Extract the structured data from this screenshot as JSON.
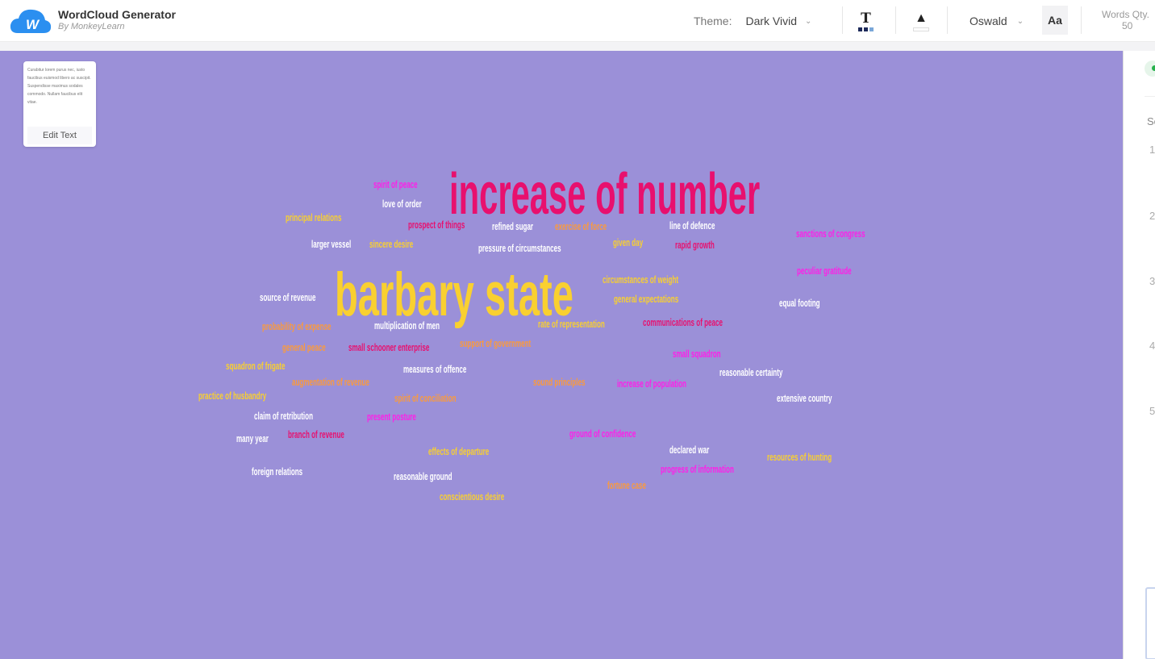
{
  "header": {
    "title": "WordCloud Generator",
    "subtitle": "By MonkeyLearn",
    "theme_label": "Theme:",
    "theme_value": "Dark Vivid",
    "font_value": "Oswald",
    "font_case_label": "Aa",
    "words_qty_label": "Words Qty.",
    "words_qty_value": "50"
  },
  "colors": {
    "canvas_bg": "#9b90d8",
    "pink": "#e8106e",
    "magenta": "#ff1ee8",
    "yellow": "#f9d030",
    "orange": "#fb9a3c",
    "white": "#ffffff"
  },
  "text_card": {
    "preview": "Curabitur lorem purus nec, iusto faucibus euismod libero ac suscipit. Suspendisse maximus sodales commodo. Nullam faucibus elit vitae.",
    "edit_label": "Edit Text"
  },
  "right_panel": {
    "heading": "Se",
    "numbers": [
      "1",
      "2",
      "3",
      "4",
      "5"
    ]
  },
  "words": [
    {
      "text": "increase of number",
      "color": "#e8106e"
    },
    {
      "text": "barbary state",
      "color": "#f9d030"
    },
    {
      "text": "spirit of peace",
      "color": "#ff1ee8"
    },
    {
      "text": "love of order",
      "color": "#ffffff"
    },
    {
      "text": "principal relations",
      "color": "#f9d030"
    },
    {
      "text": "prospect of things",
      "color": "#e8106e"
    },
    {
      "text": "refined sugar",
      "color": "#ffffff"
    },
    {
      "text": "exercise of force",
      "color": "#fb9a3c"
    },
    {
      "text": "line of defence",
      "color": "#ffffff"
    },
    {
      "text": "sanctions of congress",
      "color": "#ff1ee8"
    },
    {
      "text": "larger vessel",
      "color": "#ffffff"
    },
    {
      "text": "sincere desire",
      "color": "#f9d030"
    },
    {
      "text": "pressure of circumstances",
      "color": "#ffffff"
    },
    {
      "text": "given day",
      "color": "#f9d030"
    },
    {
      "text": "rapid growth",
      "color": "#e8106e"
    },
    {
      "text": "peculiar gratitude",
      "color": "#ff1ee8"
    },
    {
      "text": "circumstances of weight",
      "color": "#f9d030"
    },
    {
      "text": "source of revenue",
      "color": "#ffffff"
    },
    {
      "text": "general expectations",
      "color": "#f9d030"
    },
    {
      "text": "equal footing",
      "color": "#ffffff"
    },
    {
      "text": "probability of expense",
      "color": "#fb9a3c"
    },
    {
      "text": "multiplication of men",
      "color": "#ffffff"
    },
    {
      "text": "rate of representation",
      "color": "#f9d030"
    },
    {
      "text": "communications of peace",
      "color": "#e8106e"
    },
    {
      "text": "general peace",
      "color": "#fb9a3c"
    },
    {
      "text": "small schooner enterprise",
      "color": "#e8106e"
    },
    {
      "text": "support of government",
      "color": "#fb9a3c"
    },
    {
      "text": "small squadron",
      "color": "#ff1ee8"
    },
    {
      "text": "squadron of frigate",
      "color": "#f9d030"
    },
    {
      "text": "measures of offence",
      "color": "#ffffff"
    },
    {
      "text": "reasonable certainty",
      "color": "#ffffff"
    },
    {
      "text": "augmentation of revenue",
      "color": "#fb9a3c"
    },
    {
      "text": "sound principles",
      "color": "#fb9a3c"
    },
    {
      "text": "increase of population",
      "color": "#ff1ee8"
    },
    {
      "text": "practice of husbandry",
      "color": "#f9d030"
    },
    {
      "text": "spirit of conciliation",
      "color": "#fb9a3c"
    },
    {
      "text": "extensive country",
      "color": "#ffffff"
    },
    {
      "text": "claim of retribution",
      "color": "#ffffff"
    },
    {
      "text": "present posture",
      "color": "#ff1ee8"
    },
    {
      "text": "ground of confidence",
      "color": "#ff1ee8"
    },
    {
      "text": "many year",
      "color": "#ffffff"
    },
    {
      "text": "branch of revenue",
      "color": "#e8106e"
    },
    {
      "text": "effects of departure",
      "color": "#f9d030"
    },
    {
      "text": "declared war",
      "color": "#ffffff"
    },
    {
      "text": "resources of hunting",
      "color": "#f9d030"
    },
    {
      "text": "progress of information",
      "color": "#ff1ee8"
    },
    {
      "text": "foreign relations",
      "color": "#ffffff"
    },
    {
      "text": "reasonable ground",
      "color": "#ffffff"
    },
    {
      "text": "fortune case",
      "color": "#fb9a3c"
    },
    {
      "text": "conscientious desire",
      "color": "#f9d030"
    }
  ]
}
